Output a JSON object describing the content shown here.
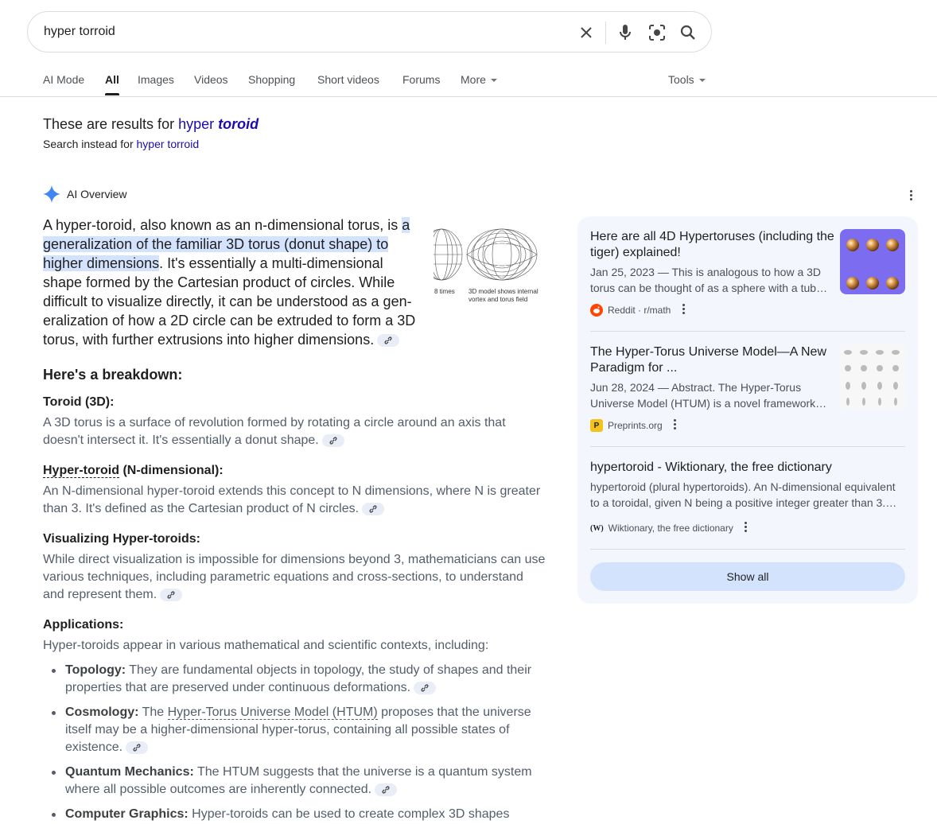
{
  "search": {
    "query": "hyper torroid",
    "icons": [
      "close-icon",
      "mic-icon",
      "lens-icon",
      "search-icon"
    ]
  },
  "tabs": [
    {
      "label": "AI Mode"
    },
    {
      "label": "All",
      "active": true
    },
    {
      "label": "Images"
    },
    {
      "label": "Videos"
    },
    {
      "label": "Shopping"
    },
    {
      "label": "Short videos"
    },
    {
      "label": "Forums"
    },
    {
      "label": "More"
    }
  ],
  "tools_label": "Tools",
  "correction": {
    "prefix": "These are results for ",
    "corrected_word1": "hyper",
    "corrected_word2": "toroid",
    "instead_prefix": "Search instead for ",
    "instead_link": "hyper torroid"
  },
  "ai_overview": {
    "label": "AI Overview",
    "intro_before": "A hyper-toroid, also known as an n-dimensional torus, is ",
    "intro_highlight": "a generalization of the familiar 3D torus (donut shape) to higher dimensions",
    "intro_after": ". It's essentially a multi-dimensional shape formed by the Cartesian product of circles. While difficult to visualize directly, it can be understood as a gen­eralization of how a 2D circle can be extruded to form a 3D torus, with further extrusions into higher dimensions.",
    "image_caption_left": "8 times",
    "image_caption_right": "3D model shows internal vortex and torus field",
    "breakdown_title": "Here's a breakdown:",
    "sections": [
      {
        "heading": "Toroid (3D):",
        "text": "A 3D torus is a surface of revolution formed by rotating a circle around an axis that doesn't intersect it. It's essentially a donut shape."
      },
      {
        "heading_link": "Hyper-toroid",
        "heading_rest": " (N-dimensional):",
        "text": "An N-dimensional hyper-toroid extends this concept to N dimensions, where N is greater than 3. It's defined as the Cartesian product of N circles."
      },
      {
        "heading": "Visualizing Hyper-toroids:",
        "text": "While direct visualization is impossible for dimensions beyond 3, mathematicians can use various techniques, including parametric equations and cross-sections, to understand and represent them."
      },
      {
        "heading": "Applications:",
        "text": "Hyper-toroids appear in various mathematical and scientific contexts, including:"
      }
    ],
    "bullets": [
      {
        "term": "Topology:",
        "text": " They are fundamental objects in topology, the study of shapes and their properties that are preserved under continuous deformations."
      },
      {
        "term": "Cosmology:",
        "text_before": " The ",
        "link": "Hyper-Torus Universe Model (HTUM)",
        "text": " proposes that the universe itself may be a higher-dimensional hyper-torus, containing all possible states of existence."
      },
      {
        "term": "Quantum Mechanics:",
        "text": " The HTUM suggests that the universe is a quantum system where all possible outcomes are inherently connected."
      },
      {
        "term": "Computer Graphics:",
        "text": " Hyper-toroids can be used to create complex 3D shapes"
      }
    ]
  },
  "sources": [
    {
      "title": "Here are all 4D Hypertoruses (including the tiger) explained!",
      "snippet": "Jan 25, 2023 — This is analogous to how a 3D torus can be thought of as a sphere with a tub…",
      "source": "Reddit · r/math"
    },
    {
      "title": "The Hyper-Torus Universe Model—A New Paradigm for ...",
      "snippet": "Jun 28, 2024 — Abstract. The Hyper-Torus Universe Model (HTUM) is a novel framework…",
      "source": "Preprints.org"
    },
    {
      "title": "hypertoroid - Wiktionary, the free dictionary",
      "snippet": "hypertoroid (plural hypertoroids). An N-dimensional equivalent to a toroidal, given N being a positive integer greater than 3.…",
      "source": "Wiktionary, the free dictionary"
    }
  ],
  "show_all_label": "Show all",
  "colors": {
    "link": "#1a0dab",
    "highlight": "#d3e3fd",
    "panel": "#f3f6fc",
    "ai_star": "#4285f4"
  }
}
